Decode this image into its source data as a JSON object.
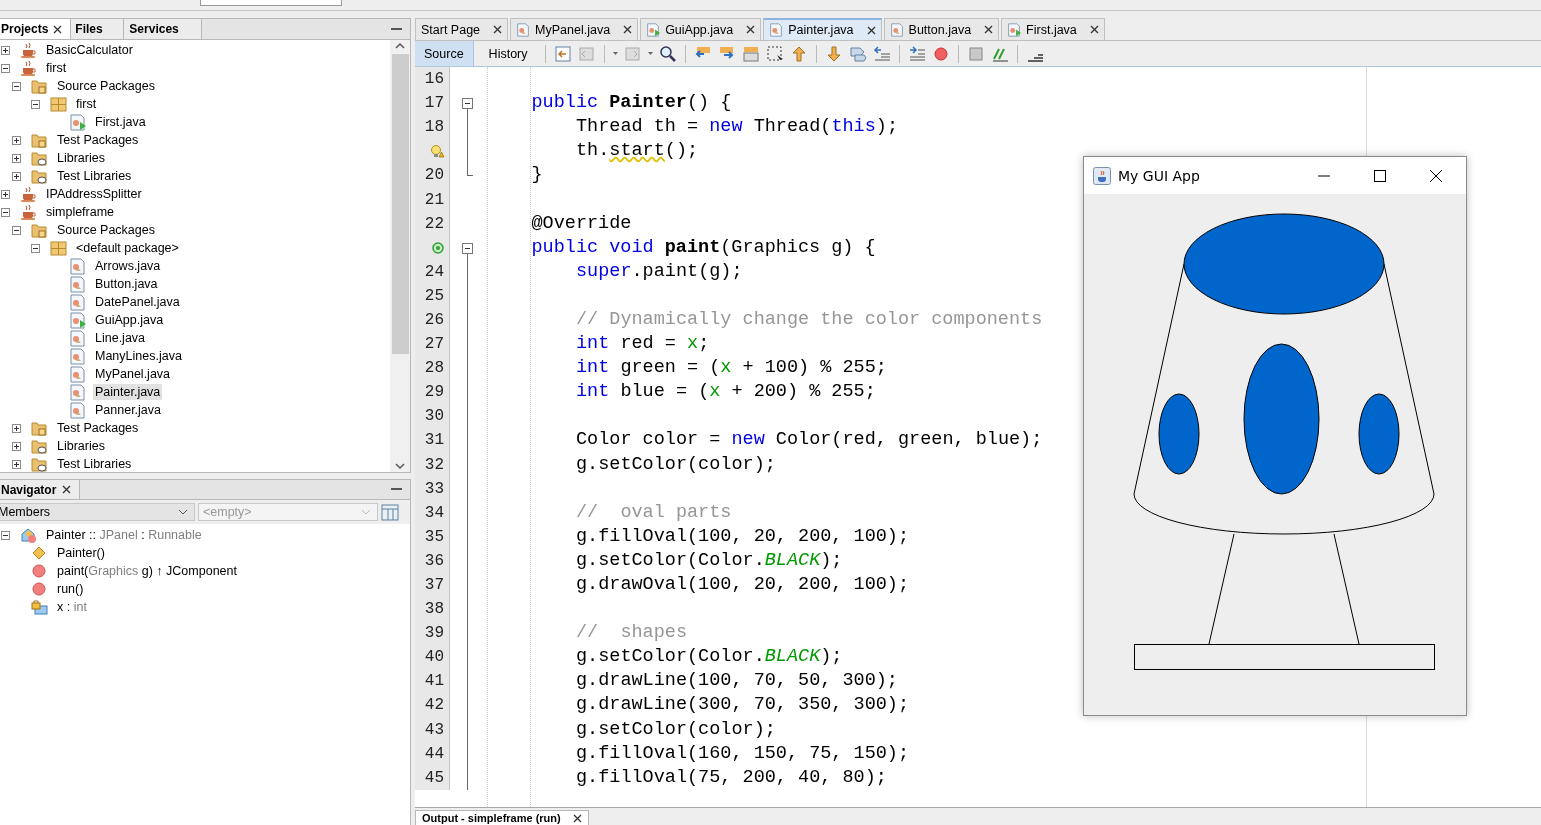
{
  "projects": {
    "tabs": [
      {
        "label": "Projects",
        "selected": true,
        "closable": true
      },
      {
        "label": "Files",
        "selected": false,
        "closable": false
      },
      {
        "label": "Services",
        "selected": false,
        "closable": false
      }
    ],
    "tree": [
      {
        "label": "BasicCalculator",
        "kind": "project",
        "expanded": false,
        "selected": false
      },
      {
        "label": "first",
        "kind": "project",
        "expanded": true,
        "selected": false,
        "children": [
          {
            "label": "Source Packages",
            "kind": "source-folder",
            "expanded": true,
            "selected": false,
            "children": [
              {
                "label": "first",
                "kind": "package",
                "expanded": true,
                "selected": false,
                "children": [
                  {
                    "label": "First.java",
                    "kind": "main-class",
                    "selected": false
                  }
                ]
              }
            ]
          },
          {
            "label": "Test Packages",
            "kind": "test-folder",
            "expanded": false,
            "selected": false
          },
          {
            "label": "Libraries",
            "kind": "library",
            "expanded": false,
            "selected": false
          },
          {
            "label": "Test Libraries",
            "kind": "library",
            "expanded": false,
            "selected": false
          }
        ]
      },
      {
        "label": "IPAddressSplitter",
        "kind": "project",
        "expanded": false,
        "selected": false
      },
      {
        "label": "simpleframe",
        "kind": "project",
        "expanded": true,
        "selected": false,
        "children": [
          {
            "label": "Source Packages",
            "kind": "source-folder",
            "expanded": true,
            "selected": false,
            "children": [
              {
                "label": "<default package>",
                "kind": "package",
                "expanded": true,
                "selected": false,
                "children": [
                  {
                    "label": "Arrows.java",
                    "kind": "class",
                    "selected": false
                  },
                  {
                    "label": "Button.java",
                    "kind": "class",
                    "selected": false
                  },
                  {
                    "label": "DatePanel.java",
                    "kind": "class",
                    "selected": false
                  },
                  {
                    "label": "GuiApp.java",
                    "kind": "main-class",
                    "selected": false
                  },
                  {
                    "label": "Line.java",
                    "kind": "class",
                    "selected": false
                  },
                  {
                    "label": "ManyLines.java",
                    "kind": "class",
                    "selected": false
                  },
                  {
                    "label": "MyPanel.java",
                    "kind": "class",
                    "selected": false
                  },
                  {
                    "label": "Painter.java",
                    "kind": "class",
                    "selected": true
                  },
                  {
                    "label": "Panner.java",
                    "kind": "class",
                    "selected": false
                  }
                ]
              }
            ]
          },
          {
            "label": "Test Packages",
            "kind": "test-folder",
            "expanded": false,
            "selected": false
          },
          {
            "label": "Libraries",
            "kind": "library",
            "expanded": false,
            "selected": false
          },
          {
            "label": "Test Libraries",
            "kind": "library",
            "expanded": false,
            "selected": false
          }
        ]
      }
    ]
  },
  "navigator": {
    "title": "Navigator",
    "filter": "Members",
    "scope_placeholder": "<empty>",
    "tree": [
      {
        "kind": "class",
        "expanded": true,
        "selected": false,
        "parts": [
          {
            "text": "Painter :: ",
            "muted": false
          },
          {
            "text": "JPanel",
            "muted": true
          },
          {
            "text": " : ",
            "muted": false
          },
          {
            "text": "Runnable",
            "muted": true
          }
        ],
        "children": [
          {
            "kind": "constructor",
            "selected": false,
            "parts": [
              {
                "text": "Painter()",
                "muted": false
              }
            ]
          },
          {
            "kind": "method",
            "selected": false,
            "parts": [
              {
                "text": "paint(",
                "muted": false
              },
              {
                "text": "Graphics",
                "muted": true
              },
              {
                "text": " g) ↑ JComponent",
                "muted": false
              }
            ]
          },
          {
            "kind": "method",
            "selected": false,
            "parts": [
              {
                "text": "run()",
                "muted": false
              }
            ]
          },
          {
            "kind": "field",
            "selected": false,
            "parts": [
              {
                "text": "x : ",
                "muted": false
              },
              {
                "text": "int",
                "muted": true
              }
            ]
          }
        ]
      }
    ]
  },
  "editor": {
    "tabs": [
      {
        "label": "Start Page",
        "kind": "page",
        "selected": false
      },
      {
        "label": "MyPanel.java",
        "kind": "class",
        "selected": false
      },
      {
        "label": "GuiApp.java",
        "kind": "main-class",
        "selected": false
      },
      {
        "label": "Painter.java",
        "kind": "class",
        "selected": true
      },
      {
        "label": "Button.java",
        "kind": "class",
        "selected": false
      },
      {
        "label": "First.java",
        "kind": "main-class",
        "selected": false
      }
    ],
    "views": [
      {
        "label": "Source",
        "selected": true
      },
      {
        "label": "History",
        "selected": false
      }
    ],
    "lines": [
      {
        "number": "16",
        "warning": false,
        "override": false,
        "fold_start": false,
        "in_fold": false,
        "fold_end": false
      },
      {
        "number": "17",
        "warning": false,
        "override": false,
        "fold_start": true,
        "in_fold": false,
        "fold_end": false,
        "tokens": [
          {
            "kind": "keyword",
            "t": "public "
          },
          {
            "kind": "declaration",
            "t": "Painter"
          },
          {
            "kind": "plain",
            "t": "() {"
          }
        ]
      },
      {
        "number": "18",
        "warning": false,
        "override": false,
        "fold_start": false,
        "in_fold": true,
        "fold_end": false,
        "tokens": [
          {
            "kind": "plain",
            "t": "Thread th = "
          },
          {
            "kind": "keyword",
            "t": "new"
          },
          {
            "kind": "plain",
            "t": " Thread("
          },
          {
            "kind": "keyword",
            "t": "this"
          },
          {
            "kind": "plain",
            "t": ");"
          }
        ]
      },
      {
        "warning": true,
        "override": false,
        "fold_start": false,
        "in_fold": true,
        "fold_end": false,
        "tokens": [
          {
            "kind": "plain",
            "t": "th."
          },
          {
            "kind": "warning",
            "t": "start"
          },
          {
            "kind": "plain",
            "t": "();"
          }
        ]
      },
      {
        "number": "20",
        "warning": false,
        "override": false,
        "fold_start": false,
        "in_fold": false,
        "fold_end": true,
        "tokens": [
          {
            "kind": "plain",
            "t": "}"
          }
        ]
      },
      {
        "number": "21",
        "warning": false,
        "override": false,
        "fold_start": false,
        "in_fold": false,
        "fold_end": false
      },
      {
        "number": "22",
        "warning": false,
        "override": false,
        "fold_start": false,
        "in_fold": false,
        "fold_end": false,
        "tokens": [
          {
            "kind": "plain",
            "t": "@Override"
          }
        ]
      },
      {
        "warning": false,
        "override": true,
        "fold_start": true,
        "in_fold": false,
        "fold_end": false,
        "tokens": [
          {
            "kind": "keyword",
            "t": "public void "
          },
          {
            "kind": "declaration",
            "t": "paint"
          },
          {
            "kind": "plain",
            "t": "(Graphics g) {"
          }
        ]
      },
      {
        "number": "24",
        "warning": false,
        "override": false,
        "fold_start": false,
        "in_fold": true,
        "fold_end": false,
        "tokens": [
          {
            "kind": "keyword",
            "t": "super"
          },
          {
            "kind": "plain",
            "t": ".paint(g);"
          }
        ]
      },
      {
        "number": "25",
        "warning": false,
        "override": false,
        "fold_start": false,
        "in_fold": true,
        "fold_end": false
      },
      {
        "number": "26",
        "warning": false,
        "override": false,
        "fold_start": false,
        "in_fold": true,
        "fold_end": false,
        "tokens": [
          {
            "kind": "comment",
            "t": "// Dynamically change the color components"
          }
        ]
      },
      {
        "number": "27",
        "warning": false,
        "override": false,
        "fold_start": false,
        "in_fold": true,
        "fold_end": false,
        "tokens": [
          {
            "kind": "keyword",
            "t": "int"
          },
          {
            "kind": "plain",
            "t": " red = "
          },
          {
            "kind": "field",
            "t": "x"
          },
          {
            "kind": "plain",
            "t": ";"
          }
        ]
      },
      {
        "number": "28",
        "warning": false,
        "override": false,
        "fold_start": false,
        "in_fold": true,
        "fold_end": false,
        "tokens": [
          {
            "kind": "keyword",
            "t": "int"
          },
          {
            "kind": "plain",
            "t": " green = ("
          },
          {
            "kind": "field",
            "t": "x"
          },
          {
            "kind": "plain",
            "t": " + 100) % 255;"
          }
        ]
      },
      {
        "number": "29",
        "warning": false,
        "override": false,
        "fold_start": false,
        "in_fold": true,
        "fold_end": false,
        "tokens": [
          {
            "kind": "keyword",
            "t": "int"
          },
          {
            "kind": "plain",
            "t": " blue = ("
          },
          {
            "kind": "field",
            "t": "x"
          },
          {
            "kind": "plain",
            "t": " + 200) % 255;"
          }
        ]
      },
      {
        "number": "30",
        "warning": false,
        "override": false,
        "fold_start": false,
        "in_fold": true,
        "fold_end": false
      },
      {
        "number": "31",
        "warning": false,
        "override": false,
        "fold_start": false,
        "in_fold": true,
        "fold_end": false,
        "tokens": [
          {
            "kind": "plain",
            "t": "Color color = "
          },
          {
            "kind": "keyword",
            "t": "new"
          },
          {
            "kind": "plain",
            "t": " Color(red, green, blue);"
          }
        ]
      },
      {
        "number": "32",
        "warning": false,
        "override": false,
        "fold_start": false,
        "in_fold": true,
        "fold_end": false,
        "tokens": [
          {
            "kind": "plain",
            "t": "g.setColor(color);"
          }
        ]
      },
      {
        "number": "33",
        "warning": false,
        "override": false,
        "fold_start": false,
        "in_fold": true,
        "fold_end": false
      },
      {
        "number": "34",
        "warning": false,
        "override": false,
        "fold_start": false,
        "in_fold": true,
        "fold_end": false,
        "tokens": [
          {
            "kind": "comment",
            "t": "//  oval parts"
          }
        ]
      },
      {
        "number": "35",
        "warning": false,
        "override": false,
        "fold_start": false,
        "in_fold": true,
        "fold_end": false,
        "tokens": [
          {
            "kind": "plain",
            "t": "g.fillOval(100, 20, 200, 100);"
          }
        ]
      },
      {
        "number": "36",
        "warning": false,
        "override": false,
        "fold_start": false,
        "in_fold": true,
        "fold_end": false,
        "tokens": [
          {
            "kind": "plain",
            "t": "g.setColor(Color."
          },
          {
            "kind": "constant",
            "t": "BLACK"
          },
          {
            "kind": "plain",
            "t": ");"
          }
        ]
      },
      {
        "number": "37",
        "warning": false,
        "override": false,
        "fold_start": false,
        "in_fold": true,
        "fold_end": false,
        "tokens": [
          {
            "kind": "plain",
            "t": "g.drawOval(100, 20, 200, 100);"
          }
        ]
      },
      {
        "number": "38",
        "warning": false,
        "override": false,
        "fold_start": false,
        "in_fold": true,
        "fold_end": false
      },
      {
        "number": "39",
        "warning": false,
        "override": false,
        "fold_start": false,
        "in_fold": true,
        "fold_end": false,
        "tokens": [
          {
            "kind": "comment",
            "t": "//  shapes"
          }
        ]
      },
      {
        "number": "40",
        "warning": false,
        "override": false,
        "fold_start": false,
        "in_fold": true,
        "fold_end": false,
        "tokens": [
          {
            "kind": "plain",
            "t": "g.setColor(Color."
          },
          {
            "kind": "constant",
            "t": "BLACK"
          },
          {
            "kind": "plain",
            "t": ");"
          }
        ]
      },
      {
        "number": "41",
        "warning": false,
        "override": false,
        "fold_start": false,
        "in_fold": true,
        "fold_end": false,
        "tokens": [
          {
            "kind": "plain",
            "t": "g.drawLine(100, 70, 50, 300);"
          }
        ]
      },
      {
        "number": "42",
        "warning": false,
        "override": false,
        "fold_start": false,
        "in_fold": true,
        "fold_end": false,
        "tokens": [
          {
            "kind": "plain",
            "t": "g.drawLine(300, 70, 350, 300);"
          }
        ]
      },
      {
        "number": "43",
        "warning": false,
        "override": false,
        "fold_start": false,
        "in_fold": true,
        "fold_end": false,
        "tokens": [
          {
            "kind": "plain",
            "t": "g.setColor(color);"
          }
        ]
      },
      {
        "number": "44",
        "warning": false,
        "override": false,
        "fold_start": false,
        "in_fold": true,
        "fold_end": false,
        "tokens": [
          {
            "kind": "plain",
            "t": "g.fillOval(160, 150, 75, 150);"
          }
        ]
      },
      {
        "number": "45",
        "warning": false,
        "override": false,
        "fold_start": false,
        "in_fold": true,
        "fold_end": false,
        "tokens": [
          {
            "kind": "plain",
            "t": "g.fillOval(75, 200, 40, 80);"
          }
        ]
      }
    ]
  },
  "app_window": {
    "title": "My GUI App"
  },
  "output": {
    "tab": "Output - simpleframe (run)"
  }
}
